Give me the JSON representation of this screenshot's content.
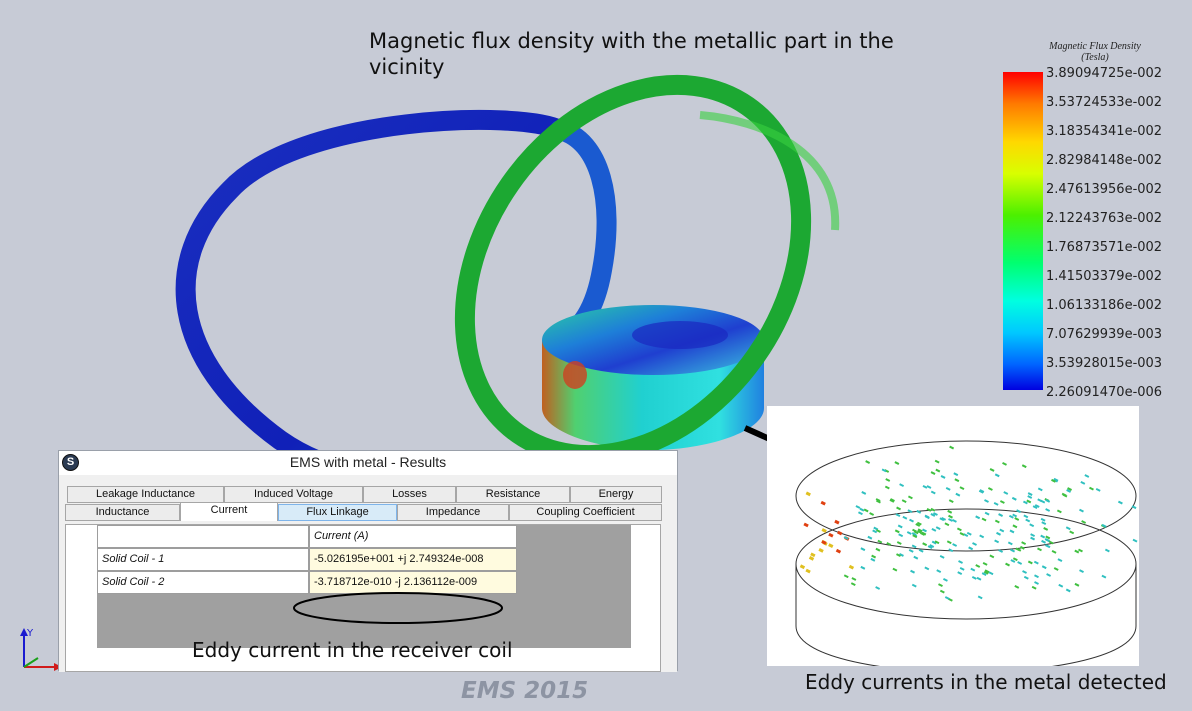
{
  "title": "Magnetic flux density with the metallic part in the vicinity",
  "legend": {
    "title": "Magnetic Flux Density",
    "unit": "(Tesla)",
    "values": [
      "3.89094725e-002",
      "3.53724533e-002",
      "3.18354341e-002",
      "2.82984148e-002",
      "2.47613956e-002",
      "2.12243763e-002",
      "1.76873571e-002",
      "1.41503379e-002",
      "1.06133186e-002",
      "7.07629939e-003",
      "3.53928015e-003",
      "2.26091470e-006"
    ]
  },
  "window": {
    "title": "EMS with metal - Results",
    "icon_text": "S",
    "tabs_row1": [
      "Leakage Inductance",
      "Induced Voltage",
      "Losses",
      "Resistance",
      "Energy"
    ],
    "tabs_row2": [
      "Inductance",
      "Current",
      "Flux Linkage",
      "Impedance",
      "Coupling Coefficient"
    ],
    "active_tab": "Current",
    "table": {
      "header": "Current (A)",
      "rows": [
        {
          "name": "Solid Coil - 1",
          "value": "-5.026195e+001 +j 2.749324e-008"
        },
        {
          "name": "Solid Coil - 2",
          "value": "-3.718712e-010 -j 2.136112e-009"
        }
      ]
    }
  },
  "annotations": {
    "eddy_receiver": "Eddy current in the receiver coil",
    "eddy_metal": "Eddy currents in the metal detected"
  },
  "watermark": "EMS 2015",
  "axes": {
    "y_label": "Y"
  }
}
